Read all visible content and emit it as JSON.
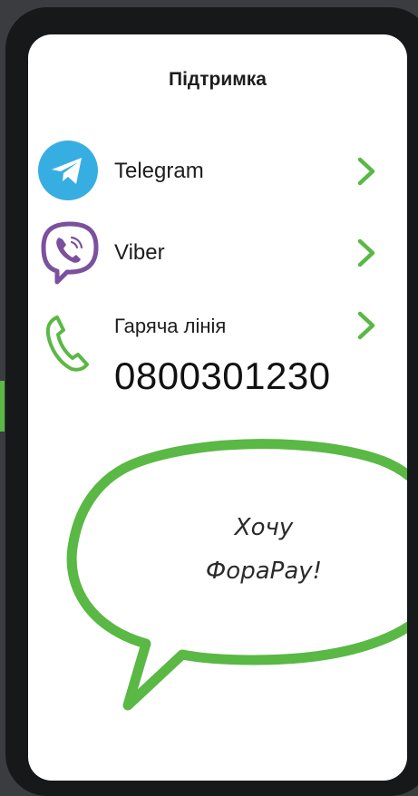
{
  "header": {
    "title": "Підтримка"
  },
  "contacts": [
    {
      "label": "Telegram",
      "icon": "telegram-icon"
    },
    {
      "label": "Viber",
      "icon": "viber-icon"
    },
    {
      "label": "Гаряча лінія",
      "icon": "phone-handset-icon",
      "number": "0800301230"
    }
  ],
  "bubble": {
    "line1": "Хочу",
    "line2": "ФораPay!"
  },
  "colors": {
    "accent_green": "#5ab845",
    "telegram_blue": "#37aee2",
    "viber_purple": "#7b519d",
    "frame": "#17181a",
    "background": "#3b3c40"
  }
}
